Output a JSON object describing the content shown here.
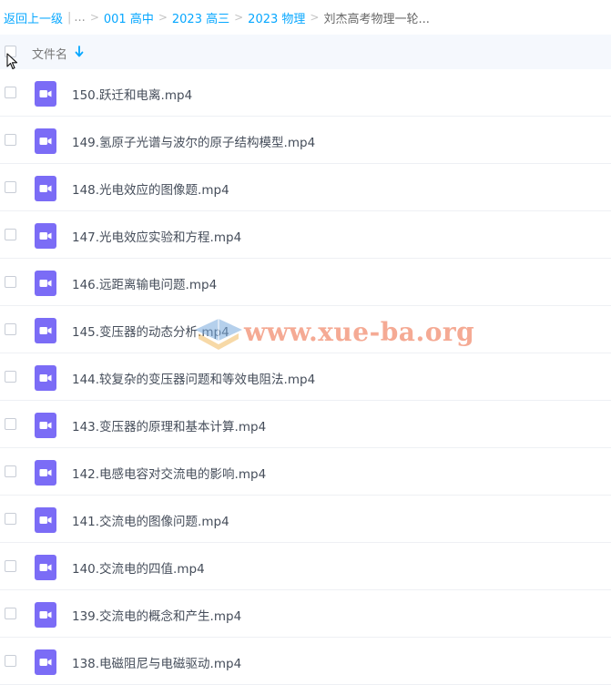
{
  "breadcrumb": {
    "back": "返回上一级",
    "ellipsis": "...",
    "items": [
      "001 高中",
      "2023 高三",
      "2023 物理"
    ],
    "current": "刘杰高考物理一轮..."
  },
  "header": {
    "column_name": "文件名"
  },
  "files": [
    "150.跃迁和电离.mp4",
    "149.氢原子光谱与波尔的原子结构模型.mp4",
    "148.光电效应的图像题.mp4",
    "147.光电效应实验和方程.mp4",
    "146.远距离输电问题.mp4",
    "145.变压器的动态分析.mp4",
    "144.较复杂的变压器问题和等效电阻法.mp4",
    "143.变压器的原理和基本计算.mp4",
    "142.电感电容对交流电的影响.mp4",
    "141.交流电的图像问题.mp4",
    "140.交流电的四值.mp4",
    "139.交流电的概念和产生.mp4",
    "138.电磁阻尼与电磁驱动.mp4"
  ],
  "watermark": {
    "text": "www.xue-ba.org"
  },
  "colors": {
    "link": "#06a7ff",
    "video_icon": "#7b6cf6",
    "header_bg": "#f5f8fd"
  }
}
